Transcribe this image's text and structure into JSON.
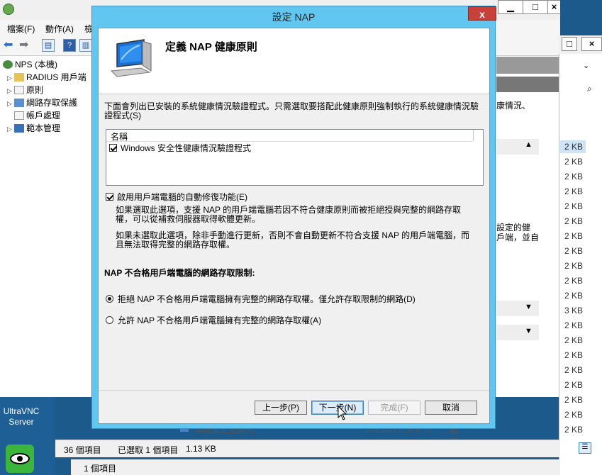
{
  "mmc": {
    "title_visible": "",
    "menu": [
      "檔案(F)",
      "動作(A)",
      "檢"
    ],
    "tree": [
      {
        "label": "NPS (本機)",
        "root": true
      },
      {
        "label": "RADIUS 用戶端",
        "expandable": true
      },
      {
        "label": "原則",
        "expandable": true
      },
      {
        "label": "網路存取保護",
        "expandable": true
      },
      {
        "label": "帳戶處理",
        "expandable": false
      },
      {
        "label": "範本管理",
        "expandable": true
      }
    ],
    "behind_text": {
      "right1": "康情況、",
      "right2": "設定的健",
      "right3": "戶端，並自"
    },
    "status": {
      "count": "36 個項目",
      "selected": "已選取 1 個項目",
      "size": "1.13 KB",
      "second_count": "1 個項目"
    },
    "behind_row": {
      "name": "本機安全性原則",
      "date": "2013/8/22 下午 0...",
      "type": "捷徑"
    }
  },
  "explorer": {
    "sizes": [
      "2 KB",
      "2 KB",
      "2 KB",
      "2 KB",
      "2 KB",
      "2 KB",
      "2 KB",
      "2 KB",
      "2 KB",
      "2 KB",
      "2 KB",
      "3 KB",
      "2 KB",
      "2 KB",
      "2 KB",
      "2 KB",
      "2 KB",
      "2 KB",
      "2 KB",
      "2 KB"
    ]
  },
  "desktop": {
    "vnc_label_1": "UltraVNC",
    "vnc_label_2": "Server"
  },
  "dialog": {
    "title": "設定 NAP",
    "close": "x",
    "header_title": "定義 NAP 健康原則",
    "description": "下面會列出已安裝的系統健康情況驗證程式。只需選取要搭配此健康原則強制執行的系統健康情況驗證程式(S)",
    "list_header": "名稱",
    "list_items": [
      {
        "label": "Windows 安全性健康情況驗證程式",
        "checked": true
      }
    ],
    "auto_remediation": {
      "label": "啟用用戶端電腦的自動修復功能(E)",
      "checked": true,
      "note1": "如果選取此選項，支援 NAP 的用戶端電腦若因不符合健康原則而被拒絕授與完整的網路存取權，可以從補救伺服器取得軟體更新。",
      "note2": "如果未選取此選項，除非手動進行更新，否則不會自動更新不符合支援 NAP 的用戶端電腦，而且無法取得完整的網路存取權。"
    },
    "restriction_title": "NAP 不合格用戶端電腦的網路存取限制:",
    "radio_options": [
      {
        "label": "拒絕 NAP 不合格用戶端電腦擁有完整的網路存取權。僅允許存取限制的網路(D)",
        "selected": true
      },
      {
        "label": "允許 NAP 不合格用戶端電腦擁有完整的網路存取權(A)",
        "selected": false
      }
    ],
    "buttons": {
      "back": "上一步(P)",
      "next": "下一步(N)",
      "finish": "完成(F)",
      "cancel": "取消"
    }
  },
  "colors": {
    "dialog_frame": "#61c7f0",
    "close_button": "#c7413a",
    "desktop": "#1c5a8c"
  }
}
